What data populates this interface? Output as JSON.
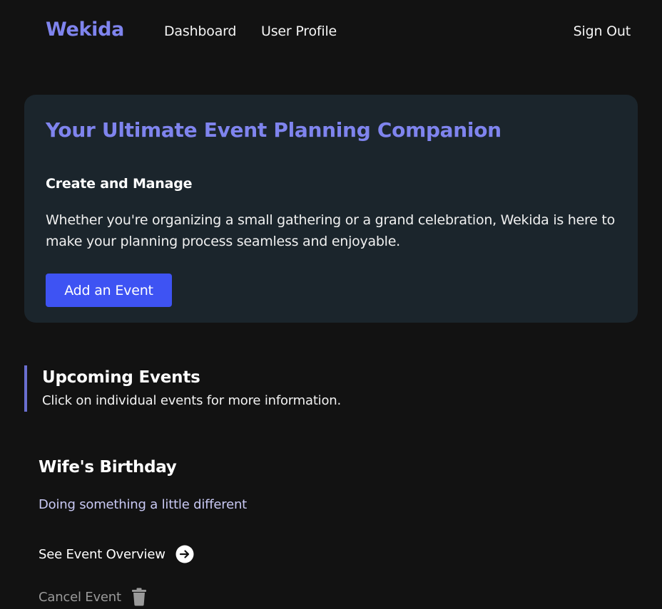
{
  "nav": {
    "brand": "Wekida",
    "links": [
      {
        "label": "Dashboard"
      },
      {
        "label": "User Profile"
      }
    ],
    "sign_out": "Sign Out"
  },
  "hero": {
    "title": "Your Ultimate Event Planning Companion",
    "subtitle": "Create and Manage",
    "description": "Whether you're organizing a small gathering or a grand celebration, Wekida is here to make your planning process seamless and enjoyable.",
    "button_label": "Add an Event"
  },
  "upcoming": {
    "title": "Upcoming Events",
    "subtitle": "Click on individual events for more information.",
    "events": [
      {
        "title": "Wife's Birthday",
        "description": "Doing something a little different",
        "overview_label": "See Event Overview",
        "overview_icon": "arrow-circle-right-icon",
        "cancel_label": "Cancel Event",
        "cancel_icon": "trash-icon"
      }
    ]
  },
  "colors": {
    "background": "#121212",
    "accent": "#7f84ee",
    "card": "#1b252c",
    "button": "#3e53f3",
    "border_accent": "#6a6fd0"
  }
}
